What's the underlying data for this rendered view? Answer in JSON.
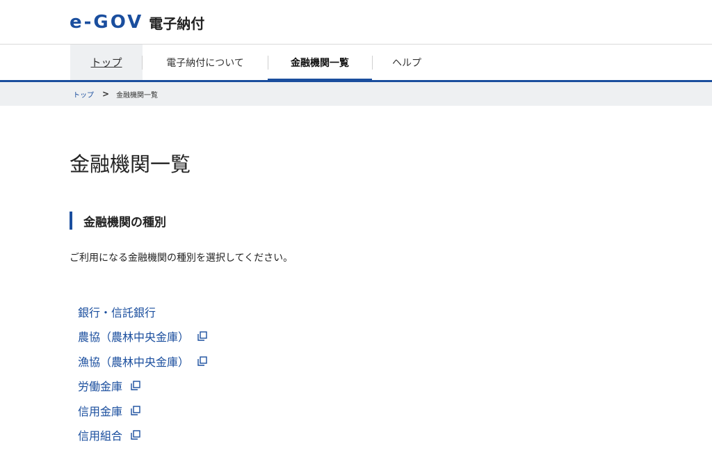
{
  "header": {
    "logo_mark": "e-GOV",
    "logo_text": "電子納付"
  },
  "nav": {
    "items": [
      {
        "label": "トップ"
      },
      {
        "label": "電子納付について"
      },
      {
        "label": "金融機関一覧",
        "active": true
      },
      {
        "label": "ヘルプ"
      }
    ]
  },
  "breadcrumb": {
    "home": "トップ",
    "separator": ">",
    "current": "金融機関一覧"
  },
  "main": {
    "title": "金融機関一覧",
    "section_heading": "金融機関の種別",
    "description": "ご利用になる金融機関の種別を選択してください。",
    "links": [
      {
        "label": "銀行・信託銀行",
        "external": false
      },
      {
        "label": "農協（農林中央金庫）",
        "external": true
      },
      {
        "label": "漁協（農林中央金庫）",
        "external": true
      },
      {
        "label": "労働金庫",
        "external": true
      },
      {
        "label": "信用金庫",
        "external": true
      },
      {
        "label": "信用組合",
        "external": true
      }
    ]
  },
  "colors": {
    "brand": "#1a4e9e",
    "nav_bg": "#eef0f2"
  },
  "icons": {
    "external": "external-link-icon"
  }
}
